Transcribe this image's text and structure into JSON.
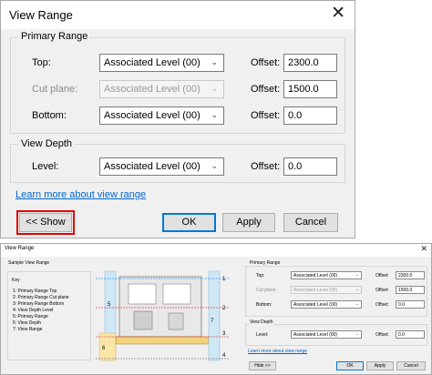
{
  "dialog_collapsed": {
    "title": "View Range",
    "close_glyph": "✕",
    "primary_range_label": "Primary Range",
    "top_label": "Top:",
    "top_level": "Associated Level (00)",
    "top_offset_label": "Offset:",
    "top_offset": "2300.0",
    "cut_label": "Cut plane:",
    "cut_level": "Associated Level (00)",
    "cut_offset_label": "Offset:",
    "cut_offset": "1500.0",
    "bottom_label": "Bottom:",
    "bottom_level": "Associated Level (00)",
    "bottom_offset_label": "Offset:",
    "bottom_offset": "0.0",
    "view_depth_label": "View Depth",
    "level_label": "Level:",
    "level_value": "Associated Level (00)",
    "level_offset_label": "Offset:",
    "level_offset": "0.0",
    "learn_more": "Learn more about view range",
    "show_button": "<< Show",
    "ok_button": "OK",
    "apply_button": "Apply",
    "cancel_button": "Cancel",
    "chevron_glyph": "⌄"
  },
  "dialog_expanded": {
    "title": "View Range",
    "close_glyph": "✕",
    "sample_label": "Sample View Range",
    "key_label": "Key",
    "key_items": [
      "1: Primary Range Top",
      "2: Primary Range Cut plane",
      "3: Primary Range Bottom",
      "4: View Depth Level",
      "5: Primary Range",
      "6: View Depth",
      "7: View Range"
    ],
    "diagram_numbers": [
      "1",
      "2",
      "3",
      "4",
      "5",
      "6",
      "7"
    ],
    "primary_range_label": "Primary Range",
    "top_label": "Top:",
    "top_level": "Associated Level (00)",
    "top_offset_label": "Offset:",
    "top_offset": "2300.0",
    "cut_label": "Cut plane:",
    "cut_level": "Associated Level (00)",
    "cut_offset_label": "Offset:",
    "cut_offset": "1500.0",
    "bottom_label": "Bottom:",
    "bottom_level": "Associated Level (00)",
    "bottom_offset_label": "Offset:",
    "bottom_offset": "0.0",
    "view_depth_label": "View Depth",
    "level_label": "Level:",
    "level_value": "Associated Level (00)",
    "level_offset_label": "Offset:",
    "level_offset": "0.0",
    "learn_more": "Learn more about view range",
    "hide_button": "Hide >>",
    "ok_button": "OK",
    "apply_button": "Apply",
    "cancel_button": "Cancel",
    "chevron_glyph": "⌄"
  },
  "colors": {
    "accent": "#0078d7",
    "highlight": "#e00000",
    "link": "#0066cc",
    "range_blue": "#9fd3f0",
    "depth_yellow": "#f5d88a"
  }
}
